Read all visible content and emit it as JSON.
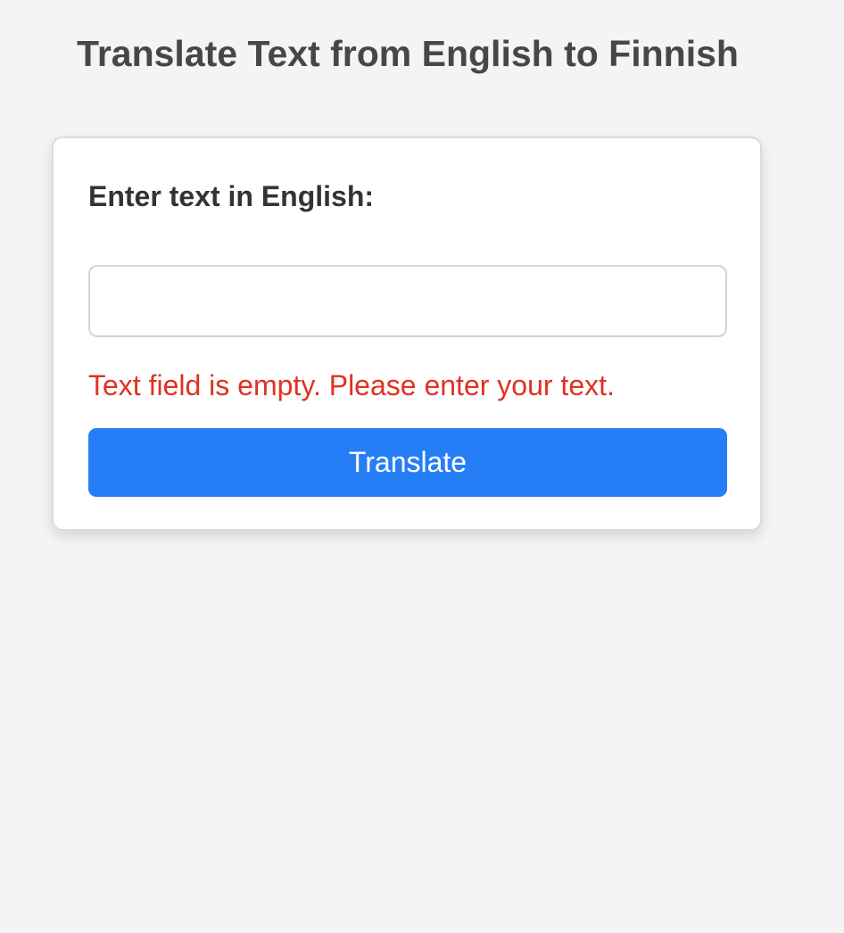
{
  "header": {
    "title": "Translate Text from English to Finnish"
  },
  "form": {
    "label": "Enter text in English:",
    "input_value": "",
    "input_placeholder": "",
    "error_message": "Text field is empty. Please enter your text.",
    "submit_label": "Translate"
  },
  "colors": {
    "background": "#f4f4f4",
    "card": "#ffffff",
    "title_text": "#474747",
    "label_text": "#333333",
    "error_text": "#e03122",
    "button_bg": "#267ef6",
    "button_text": "#ffffff"
  }
}
